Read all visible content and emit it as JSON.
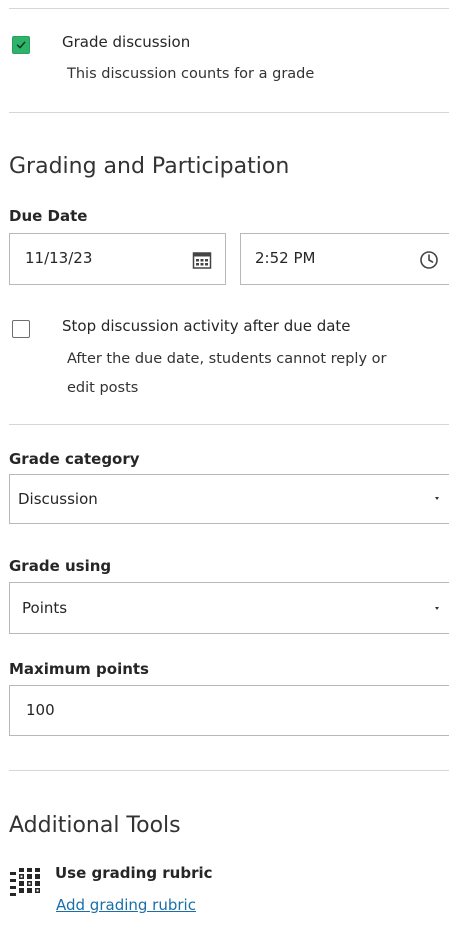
{
  "grade_discussion": {
    "checked": true,
    "label": "Grade discussion",
    "description": "This discussion counts for a grade"
  },
  "grading_section": {
    "title": "Grading and Participation",
    "due_date": {
      "label": "Due Date",
      "date_value": "11/13/23",
      "time_value": "2:52 PM",
      "date_icon": "calendar-icon",
      "time_icon": "clock-icon"
    },
    "stop_activity": {
      "checked": false,
      "label": "Stop discussion activity after due date",
      "description_line1": "After the due date, students cannot reply or",
      "description_line2": "edit posts"
    },
    "grade_category": {
      "label": "Grade category",
      "value": "Discussion"
    },
    "grade_using": {
      "label": "Grade using",
      "value": "Points"
    },
    "maximum_points": {
      "label": "Maximum points",
      "value": "100"
    }
  },
  "additional_tools": {
    "title": "Additional Tools",
    "rubric": {
      "icon": "rubric-grid-icon",
      "label": "Use grading rubric",
      "link": "Add grading rubric"
    }
  },
  "colors": {
    "checkbox_checked": "#2fb36b",
    "link": "#1a6fa8",
    "divider": "#d6d6d6",
    "input_border": "#b8b8b8"
  }
}
